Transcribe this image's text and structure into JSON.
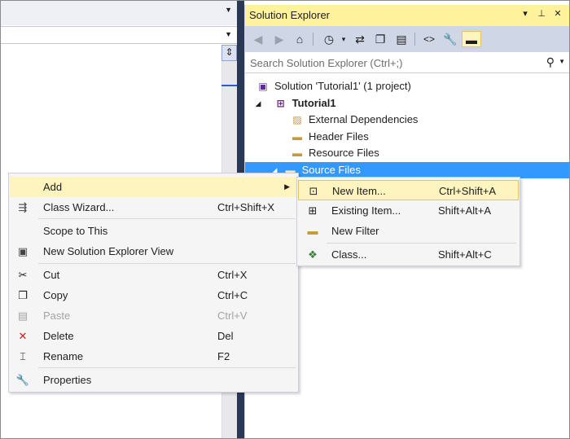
{
  "solution_explorer": {
    "title": "Solution Explorer",
    "title_buttons": [
      "▾",
      "⊥",
      "✕"
    ],
    "search_placeholder": "Search Solution Explorer (Ctrl+;)",
    "tree": {
      "solution": "Solution 'Tutorial1' (1 project)",
      "project": "Tutorial1",
      "external_dependencies": "External Dependencies",
      "header_files": "Header Files",
      "resource_files": "Resource Files",
      "source_files": "Source Files"
    },
    "colors": {
      "title_bg": "#fff29d",
      "selection": "#3399ff",
      "toolbar_bg": "#cfd6e5"
    }
  },
  "context_menu": {
    "items": [
      {
        "label": "Add",
        "shortcut": "",
        "has_submenu": true
      },
      {
        "label": "Class Wizard...",
        "shortcut": "Ctrl+Shift+X"
      },
      {
        "label": "Scope to This",
        "shortcut": ""
      },
      {
        "label": "New Solution Explorer View",
        "shortcut": ""
      },
      {
        "label": "Cut",
        "shortcut": "Ctrl+X"
      },
      {
        "label": "Copy",
        "shortcut": "Ctrl+C"
      },
      {
        "label": "Paste",
        "shortcut": "Ctrl+V",
        "disabled": true
      },
      {
        "label": "Delete",
        "shortcut": "Del"
      },
      {
        "label": "Rename",
        "shortcut": "F2"
      },
      {
        "label": "Properties",
        "shortcut": ""
      }
    ]
  },
  "submenu": {
    "items": [
      {
        "label": "New Item...",
        "shortcut": "Ctrl+Shift+A"
      },
      {
        "label": "Existing Item...",
        "shortcut": "Shift+Alt+A"
      },
      {
        "label": "New Filter",
        "shortcut": ""
      },
      {
        "label": "Class...",
        "shortcut": "Shift+Alt+C"
      }
    ]
  }
}
